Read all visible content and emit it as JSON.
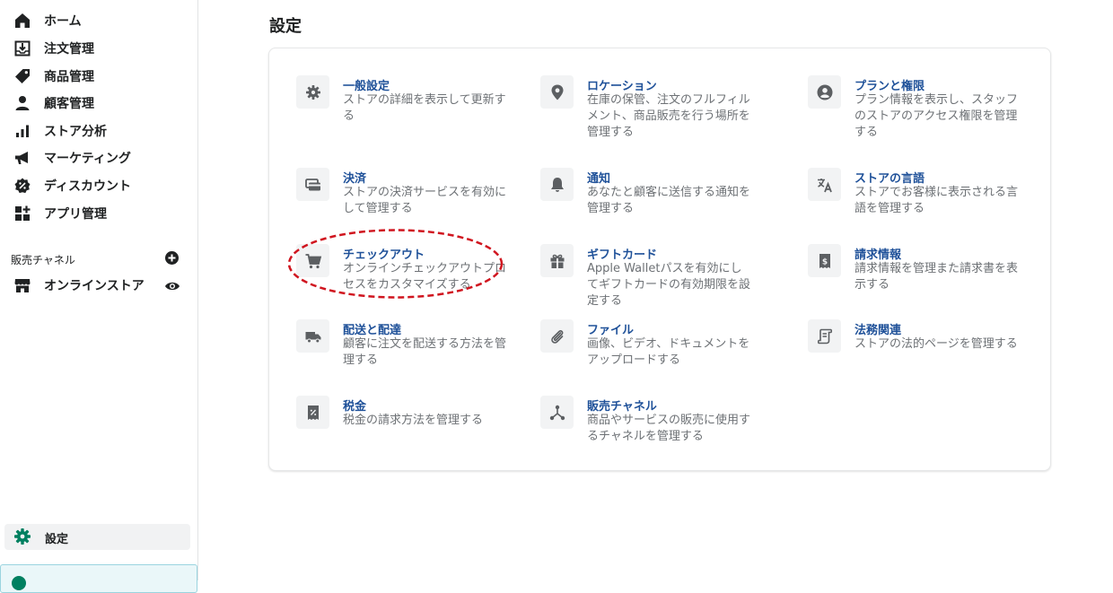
{
  "sidebar": {
    "items": [
      {
        "label": "ホーム",
        "icon": "home-icon"
      },
      {
        "label": "注文管理",
        "icon": "orders-icon"
      },
      {
        "label": "商品管理",
        "icon": "tag-icon"
      },
      {
        "label": "顧客管理",
        "icon": "person-icon"
      },
      {
        "label": "ストア分析",
        "icon": "bar-chart-icon"
      },
      {
        "label": "マーケティング",
        "icon": "megaphone-icon"
      },
      {
        "label": "ディスカウント",
        "icon": "discount-icon"
      },
      {
        "label": "アプリ管理",
        "icon": "apps-icon"
      }
    ],
    "channels": {
      "heading": "販売チャネル",
      "items": [
        {
          "label": "オンラインストア",
          "icon": "store-icon"
        }
      ]
    },
    "settings_label": "設定"
  },
  "main": {
    "title": "設定",
    "settings": [
      {
        "title": "一般設定",
        "desc": "ストアの詳細を表示して更新する",
        "icon": "gear-icon"
      },
      {
        "title": "ロケーション",
        "desc": "在庫の保管、注文のフルフィルメント、商品販売を行う場所を管理する",
        "icon": "location-pin-icon"
      },
      {
        "title": "プランと権限",
        "desc": "プラン情報を表示し、スタッフのストアのアクセス権限を管理する",
        "icon": "account-circle-icon"
      },
      {
        "title": "決済",
        "desc": "ストアの決済サービスを有効にして管理する",
        "icon": "payment-card-icon"
      },
      {
        "title": "通知",
        "desc": "あなたと顧客に送信する通知を管理する",
        "icon": "bell-icon"
      },
      {
        "title": "ストアの言語",
        "desc": "ストアでお客様に表示される言語を管理する",
        "icon": "translate-icon"
      },
      {
        "title": "チェックアウト",
        "desc": "オンラインチェックアウトプロセスをカスタマイズする",
        "icon": "cart-icon"
      },
      {
        "title": "ギフトカード",
        "desc": "Apple Walletパスを有効にしてギフトカードの有効期限を設定する",
        "icon": "gift-icon"
      },
      {
        "title": "請求情報",
        "desc": "請求情報を管理また請求書を表示する",
        "icon": "receipt-dollar-icon"
      },
      {
        "title": "配送と配達",
        "desc": "顧客に注文を配送する方法を管理する",
        "icon": "truck-icon"
      },
      {
        "title": "ファイル",
        "desc": "画像、ビデオ、ドキュメントをアップロードする",
        "icon": "paperclip-icon"
      },
      {
        "title": "法務関連",
        "desc": "ストアの法的ページを管理する",
        "icon": "legal-scroll-icon"
      },
      {
        "title": "税金",
        "desc": "税金の請求方法を管理する",
        "icon": "tax-receipt-icon"
      },
      {
        "title": "販売チャネル",
        "desc": "商品やサービスの販売に使用するチャネルを管理する",
        "icon": "channels-icon"
      }
    ]
  },
  "colors": {
    "link": "#1f5199",
    "muted": "#6d7175",
    "brand_green": "#008060",
    "highlight": "#d0151f"
  }
}
